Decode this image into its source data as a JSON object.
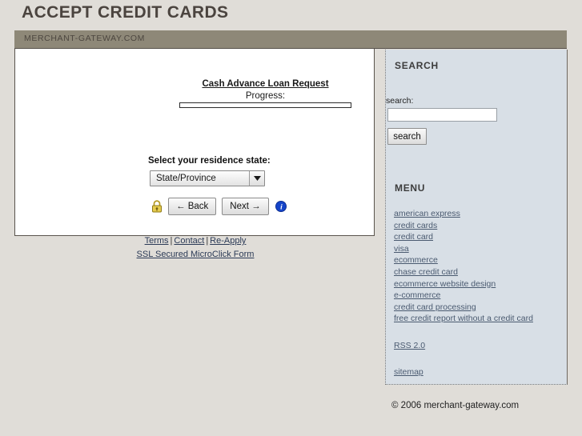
{
  "page": {
    "title": "ACCEPT CREDIT CARDS",
    "domain_bar": "MERCHANT-GATEWAY.COM"
  },
  "form": {
    "title": "Cash Advance Loan Request",
    "progress_label": "Progress:",
    "progress_percent": 0,
    "select_label": "Select your residence state:",
    "state_value": "State/Province",
    "back_label": "← Back",
    "next_label": "Next →",
    "lock_icon": "lock-icon",
    "info_icon": "info-icon",
    "dropdown_icon": "chevron-down-icon"
  },
  "panel_links": {
    "terms": "Terms",
    "separator": "|",
    "contact": "Contact",
    "reapply": "Re-Apply",
    "ssl": "SSL Secured MicroClick Form"
  },
  "sidebar": {
    "search_heading": "SEARCH",
    "search_label": "search:",
    "search_value": "",
    "search_placeholder": "",
    "search_button": "search",
    "menu_heading": "MENU",
    "menu_items": [
      "american express",
      "credit cards",
      "credit card",
      "visa",
      "ecommerce",
      "chase credit card",
      "ecommerce website design",
      "e-commerce",
      "credit card processing",
      "free credit report without a credit card"
    ],
    "rss": "RSS 2.0",
    "sitemap": "sitemap"
  },
  "footer": {
    "copyright": "© 2006 merchant-gateway.com"
  },
  "colors": {
    "page_background": "#e0ddd8",
    "domain_bar": "#8e8878",
    "sidebar_background": "#d8dfe6",
    "title_text": "#4b443f",
    "link": "#4a5a70",
    "lock": "#d6b93a",
    "info": "#1c4fd0"
  }
}
